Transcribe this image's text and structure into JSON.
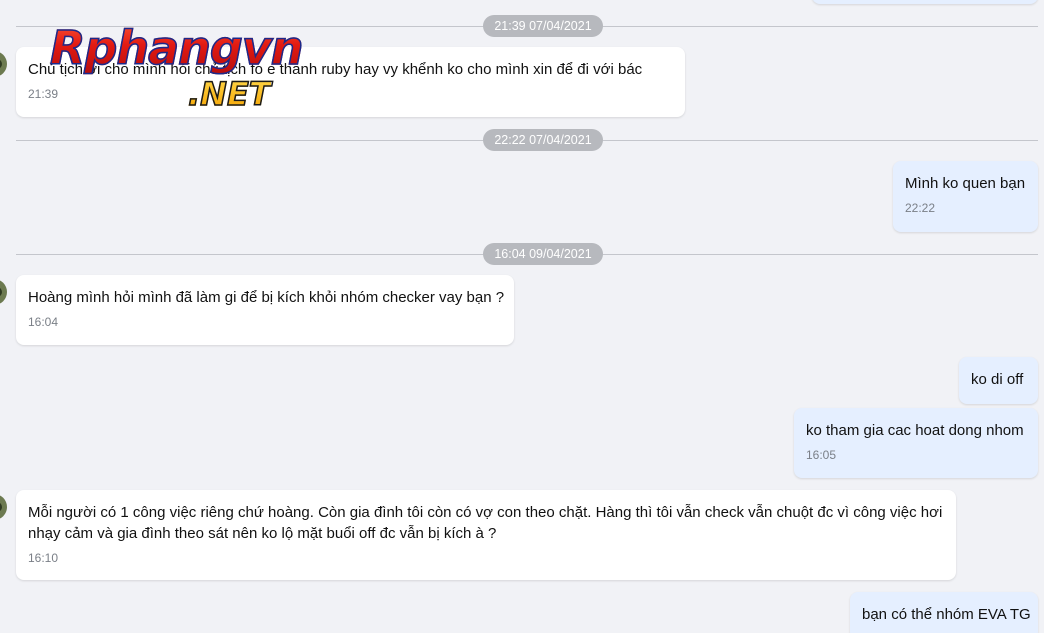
{
  "dividers": [
    {
      "label": "21:39 07/04/2021"
    },
    {
      "label": "22:22 07/04/2021"
    },
    {
      "label": "16:04 09/04/2021"
    }
  ],
  "messages": [
    {
      "direction": "in",
      "text": "Chủ tịch ơi cho mình hỏi chủ tịch  fo e thanh ruby hay vy khểnh ko cho mình xin để đi với bác",
      "time": "21:39"
    },
    {
      "direction": "out",
      "text": "Mình ko quen bạn",
      "time": "22:22"
    },
    {
      "direction": "in",
      "text": "Hoàng mình hỏi mình đã làm gi để bị kích khỏi nhóm checker vay bạn ?",
      "time": "16:04"
    },
    {
      "direction": "out",
      "text": "ko di off",
      "time": ""
    },
    {
      "direction": "out",
      "text": "ko tham gia cac hoat dong nhom",
      "time": "16:05"
    },
    {
      "direction": "in",
      "text_lines": [
        "Mỗi người có 1 công việc riêng chứ hoàng. Còn gia đình tôi còn có vợ con theo chặt. Hàng thì tôi vẫn check vẫn chuột đc vì công việc hơi",
        "nhạy cảm và gia đình theo sát nên ko lộ mặt buổi off đc vẫn bị kích à ?"
      ],
      "time": "16:10"
    },
    {
      "direction": "out",
      "text": "bạn có thể nhóm EVA TG",
      "time": ""
    }
  ],
  "watermark": {
    "main": "Rphangvn",
    "sub": ".NET"
  },
  "colors": {
    "background": "#f1f2f6",
    "incoming_bubble": "#ffffff",
    "outgoing_bubble": "#e5efff",
    "divider_pill": "#b7b9be"
  }
}
